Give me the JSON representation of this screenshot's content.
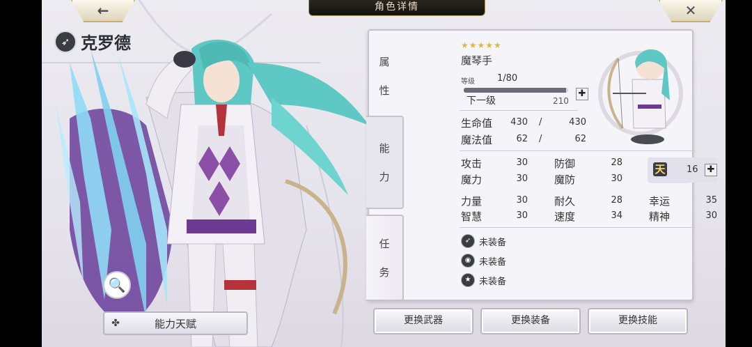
{
  "header": {
    "title": "角色详情"
  },
  "nav": {
    "back_glyph": "←",
    "close_glyph": "✕"
  },
  "character": {
    "name": "克罗德",
    "class_icon": "bow-class-icon"
  },
  "buttons": {
    "zoom_glyph": "🔍",
    "talent": "能力天赋",
    "change_weapon": "更换武器",
    "change_equipment": "更换装备",
    "change_skill": "更换技能"
  },
  "tabs": {
    "attr": [
      "属",
      "性"
    ],
    "ability": [
      "能",
      "力"
    ],
    "mission": [
      "任",
      "务"
    ]
  },
  "profile": {
    "stars": "★★★★★",
    "job": "魔琴手",
    "level_label": "等级",
    "level": "1/80",
    "exp_fraction": 0.98,
    "next_label": "下一级",
    "next_value": "210",
    "plus": "✚"
  },
  "vitals": {
    "hp_label": "生命值",
    "hp": "430",
    "hp_max": "430",
    "mp_label": "魔法值",
    "mp": "62",
    "mp_max": "62",
    "slash": "/"
  },
  "stats": {
    "atk_label": "攻击",
    "atk": "30",
    "def_label": "防御",
    "def": "28",
    "mag_label": "魔力",
    "mag": "30",
    "mdef_label": "魔防",
    "mdef": "30",
    "str_label": "力量",
    "str": "30",
    "dur_label": "耐久",
    "dur": "28",
    "luck_label": "幸运",
    "luck": "35",
    "wis_label": "智慧",
    "wis": "30",
    "spd_label": "速度",
    "spd": "34",
    "spi_label": "精神",
    "spi": "30"
  },
  "talent": {
    "badge": "天",
    "value": "16"
  },
  "equipment": [
    {
      "label": "未装备",
      "icon": "weapon-slot-icon"
    },
    {
      "label": "未装备",
      "icon": "accessory-slot-icon"
    },
    {
      "label": "未装备",
      "icon": "skill-slot-icon"
    }
  ],
  "colors": {
    "accent_gold": "#c8ac6a",
    "panel_bg": "#f5f4f8",
    "hair": "#5ec9c4",
    "ice": "#7fd2f0",
    "cape_purple": "#6a3e9a"
  }
}
